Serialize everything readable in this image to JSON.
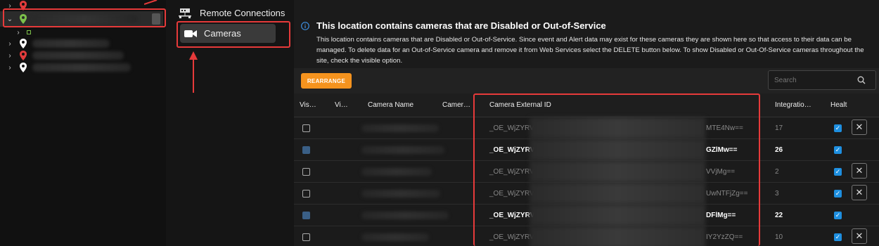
{
  "nav": {
    "remote_connections": "Remote Connections",
    "cameras": "Cameras"
  },
  "info": {
    "title": "This location contains cameras that are Disabled or Out-of-Service",
    "text": "This location contains cameras that are Disabled or Out-of-Service. Since event and Alert data may exist for these cameras they are shown here so that access to their data can be managed. To delete data for an Out-of-Service camera and remove it from Web Services select the DELETE button below. To show Disabled or Out-Of-Service cameras throughout the site, check the visible option."
  },
  "toolbar": {
    "rearrange": "REARRANGE",
    "search_placeholder": "Search"
  },
  "table": {
    "headers": [
      "Vis…",
      "Vi…",
      "Camera Name",
      "Camer…",
      "Camera External ID",
      "Integratio…",
      "Healt"
    ],
    "rows": [
      {
        "prefix": "_OE_WjZYRV",
        "suffix": "MTE4Nw==",
        "integrations": "17",
        "highlight": false,
        "visible_checked": false,
        "delete": true
      },
      {
        "prefix": "_OE_WjZYRV",
        "suffix": "GZlMw==",
        "integrations": "26",
        "highlight": true,
        "visible_checked": true,
        "delete": false
      },
      {
        "prefix": "_OE_WjZYRV",
        "suffix": "VVjMg==",
        "integrations": "2",
        "highlight": false,
        "visible_checked": false,
        "delete": true
      },
      {
        "prefix": "_OE_WjZYRV",
        "suffix": "UwNTFjZg==",
        "integrations": "3",
        "highlight": false,
        "visible_checked": false,
        "delete": true
      },
      {
        "prefix": "_OE_WjZYRV",
        "suffix": "DFlMg==",
        "integrations": "22",
        "highlight": true,
        "visible_checked": true,
        "delete": false
      },
      {
        "prefix": "_OE_WjZYRV",
        "suffix": "IY2YzZQ==",
        "integrations": "10",
        "highlight": false,
        "visible_checked": false,
        "delete": true
      }
    ]
  },
  "colors": {
    "accent": "#f5931e",
    "checkbox_blue": "#1e8fe0",
    "annotation_red": "#e63a3a",
    "pin_red": "#e23b3b",
    "pin_green": "#7cc04a",
    "pin_white": "#ffffff"
  }
}
